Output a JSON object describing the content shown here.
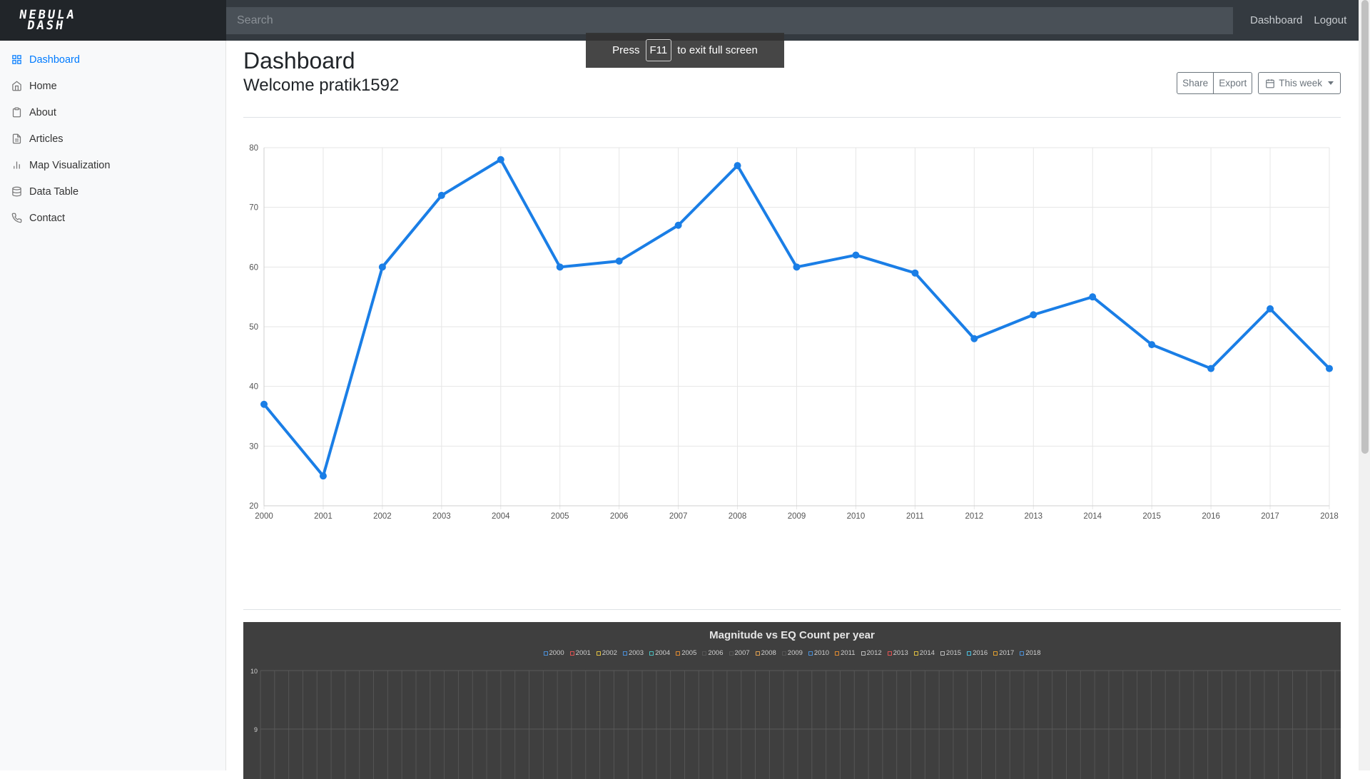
{
  "brand": {
    "line1": "NEBULA",
    "line2": "DASH"
  },
  "search": {
    "placeholder": "Search"
  },
  "nav": {
    "dashboard": "Dashboard",
    "logout": "Logout"
  },
  "toast": {
    "press": "Press",
    "key": "F11",
    "rest": "to exit full screen"
  },
  "sidebar": {
    "items": [
      {
        "label": "Dashboard",
        "icon": "grid-icon",
        "active": true
      },
      {
        "label": "Home",
        "icon": "home-icon"
      },
      {
        "label": "About",
        "icon": "clipboard-icon"
      },
      {
        "label": "Articles",
        "icon": "file-text-icon"
      },
      {
        "label": "Map Visualization",
        "icon": "bar-chart-icon"
      },
      {
        "label": "Data Table",
        "icon": "database-icon"
      },
      {
        "label": "Contact",
        "icon": "phone-icon"
      }
    ]
  },
  "header": {
    "title": "Dashboard",
    "welcome": "Welcome pratik1592"
  },
  "toolbar": {
    "share": "Share",
    "export": "Export",
    "range": "This week"
  },
  "colors": {
    "accent": "#007bff",
    "line": "#1a7ee6",
    "dark_bg": "#3f3f3f"
  },
  "chart_data": [
    {
      "type": "line",
      "x": [
        "2000",
        "2001",
        "2002",
        "2003",
        "2004",
        "2005",
        "2006",
        "2007",
        "2008",
        "2009",
        "2010",
        "2011",
        "2012",
        "2013",
        "2014",
        "2015",
        "2016",
        "2017",
        "2018"
      ],
      "series": [
        {
          "values": [
            37,
            25,
            60,
            72,
            78,
            60,
            61,
            67,
            77,
            60,
            62,
            59,
            48,
            52,
            55,
            47,
            43,
            53,
            43
          ]
        }
      ],
      "ylim": [
        20,
        80
      ],
      "yticks": [
        20,
        30,
        40,
        50,
        60,
        70,
        80
      ],
      "grid": true
    },
    {
      "type": "bar",
      "title": "Magnitude vs EQ Count per year",
      "legend": [
        "2000",
        "2001",
        "2002",
        "2003",
        "2004",
        "2005",
        "2006",
        "2007",
        "2008",
        "2009",
        "2010",
        "2011",
        "2012",
        "2013",
        "2014",
        "2015",
        "2016",
        "2017",
        "2018"
      ],
      "legend_colors": [
        "#4a90d9",
        "#e05252",
        "#e0c040",
        "#4a90d9",
        "#4ac0c0",
        "#e08a30",
        "#555555",
        "#555555",
        "#e0a050",
        "#555555",
        "#4a90d9",
        "#e08a30",
        "#bbbbbb",
        "#e05252",
        "#e0c040",
        "#bbbbbb",
        "#4ac0e0",
        "#e0a030",
        "#4a90d9"
      ],
      "yticks_visible": [
        10,
        9
      ],
      "grid": true
    }
  ]
}
